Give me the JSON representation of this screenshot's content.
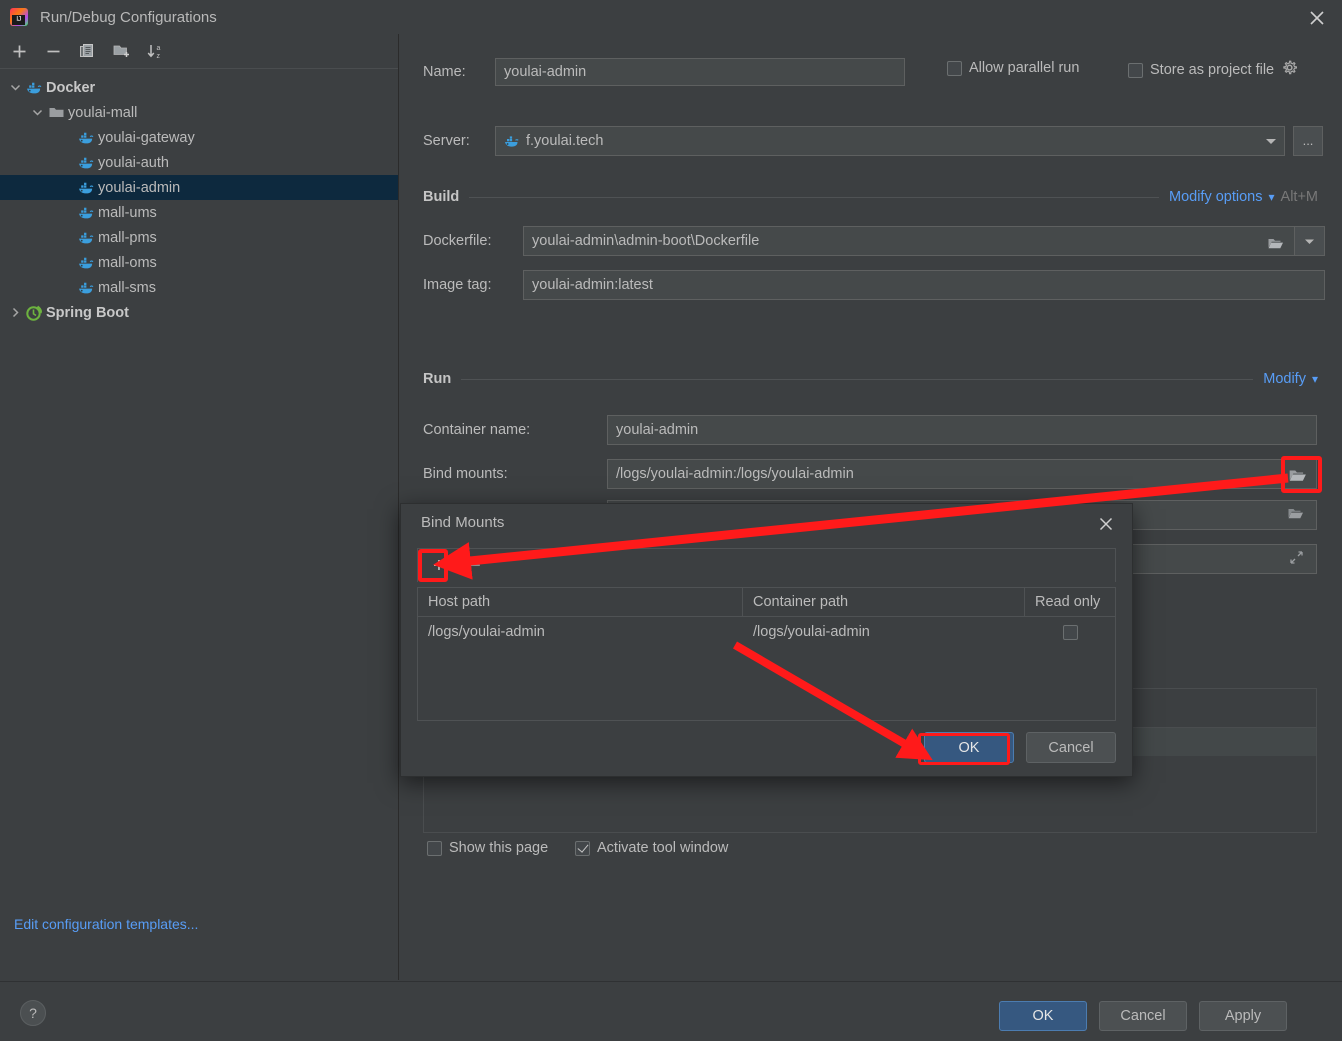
{
  "window": {
    "title": "Run/Debug Configurations",
    "logo_icon": "intellij-idea-logo",
    "close_icon": "close-icon"
  },
  "sidebar": {
    "toolbar": [
      {
        "name": "add-configuration-button",
        "icon": "plus-icon",
        "label": "+"
      },
      {
        "name": "remove-configuration-button",
        "icon": "minus-icon",
        "label": "−"
      },
      {
        "name": "copy-configuration-button",
        "icon": "copy-icon",
        "label": "Copy"
      },
      {
        "name": "new-folder-button",
        "icon": "new-folder-icon",
        "label": "New Folder"
      },
      {
        "name": "sort-configurations-button",
        "icon": "sort-alphabetically-icon",
        "label": "Sort"
      }
    ],
    "tree": [
      {
        "label": "Docker",
        "level": 1,
        "icon": "docker-icon",
        "expanded": true,
        "group": true,
        "selected": false
      },
      {
        "label": "youlai-mall",
        "level": 2,
        "icon": "folder-icon",
        "expanded": true,
        "group": false,
        "selected": false
      },
      {
        "label": "youlai-gateway",
        "level": 3,
        "icon": "docker-icon",
        "expanded": null,
        "group": false,
        "selected": false
      },
      {
        "label": "youlai-auth",
        "level": 3,
        "icon": "docker-icon",
        "expanded": null,
        "group": false,
        "selected": false
      },
      {
        "label": "youlai-admin",
        "level": 3,
        "icon": "docker-icon",
        "expanded": null,
        "group": false,
        "selected": true
      },
      {
        "label": "mall-ums",
        "level": 3,
        "icon": "docker-icon",
        "expanded": null,
        "group": false,
        "selected": false
      },
      {
        "label": "mall-pms",
        "level": 3,
        "icon": "docker-icon",
        "expanded": null,
        "group": false,
        "selected": false
      },
      {
        "label": "mall-oms",
        "level": 3,
        "icon": "docker-icon",
        "expanded": null,
        "group": false,
        "selected": false
      },
      {
        "label": "mall-sms",
        "level": 3,
        "icon": "docker-icon",
        "expanded": null,
        "group": false,
        "selected": false
      },
      {
        "label": "Spring Boot",
        "level": 1,
        "icon": "spring-boot-icon",
        "expanded": false,
        "group": true,
        "selected": false
      }
    ],
    "edit_templates_link": "Edit configuration templates..."
  },
  "main": {
    "name_label": "Name:",
    "name_value": "youlai-admin",
    "allow_parallel_run_label": "Allow parallel run",
    "allow_parallel_run_checked": false,
    "store_as_project_file_label": "Store as project file",
    "store_as_project_file_checked": false,
    "store_gear_icon": "gear-icon",
    "server_label": "Server:",
    "server_value": "f.youlai.tech",
    "server_icon": "docker-icon",
    "server_browse_label": "...",
    "build_section": {
      "title": "Build",
      "modify_options_link": "Modify options",
      "modify_options_shortcut": "Alt+M",
      "dockerfile_label": "Dockerfile:",
      "dockerfile_value": "youlai-admin\\admin-boot\\Dockerfile",
      "dockerfile_browse_icon": "folder-open-icon",
      "dockerfile_dropdown_icon": "chevron-down-icon",
      "image_tag_label": "Image tag:",
      "image_tag_value": "youlai-admin:latest"
    },
    "run_section": {
      "title": "Run",
      "modify_link": "Modify",
      "container_name_label": "Container name:",
      "container_name_value": "youlai-admin",
      "bind_mounts_label": "Bind mounts:",
      "bind_mounts_value": "/logs/youlai-admin:/logs/youlai-admin",
      "bind_mounts_browse_icon": "folder-open-icon",
      "hidden_field_browse_icon": "folder-open-icon",
      "hidden_field_expand_icon": "expand-icon"
    },
    "show_this_page_label": "Show this page",
    "show_this_page_checked": false,
    "activate_tool_window_label": "Activate tool window",
    "activate_tool_window_checked": true
  },
  "bind_mounts_dialog": {
    "title": "Bind Mounts",
    "logo_icon": "intellij-idea-logo",
    "close_icon": "close-icon",
    "add_button_label": "+",
    "remove_button_label": "−",
    "columns": [
      "Host path",
      "Container path",
      "Read only"
    ],
    "rows": [
      {
        "host_path": "/logs/youlai-admin",
        "container_path": "/logs/youlai-admin",
        "read_only": false
      }
    ],
    "ok_label": "OK",
    "cancel_label": "Cancel"
  },
  "footer": {
    "help_label": "?",
    "ok_label": "OK",
    "cancel_label": "Cancel",
    "apply_label": "Apply"
  },
  "colors": {
    "background": "#3c3f41",
    "field_background": "#45494a",
    "selection": "#0d293e",
    "link": "#589df6",
    "primary_button": "#365880",
    "annotation_red": "#ff1a1a",
    "docker_blue": "#3b9edd"
  }
}
